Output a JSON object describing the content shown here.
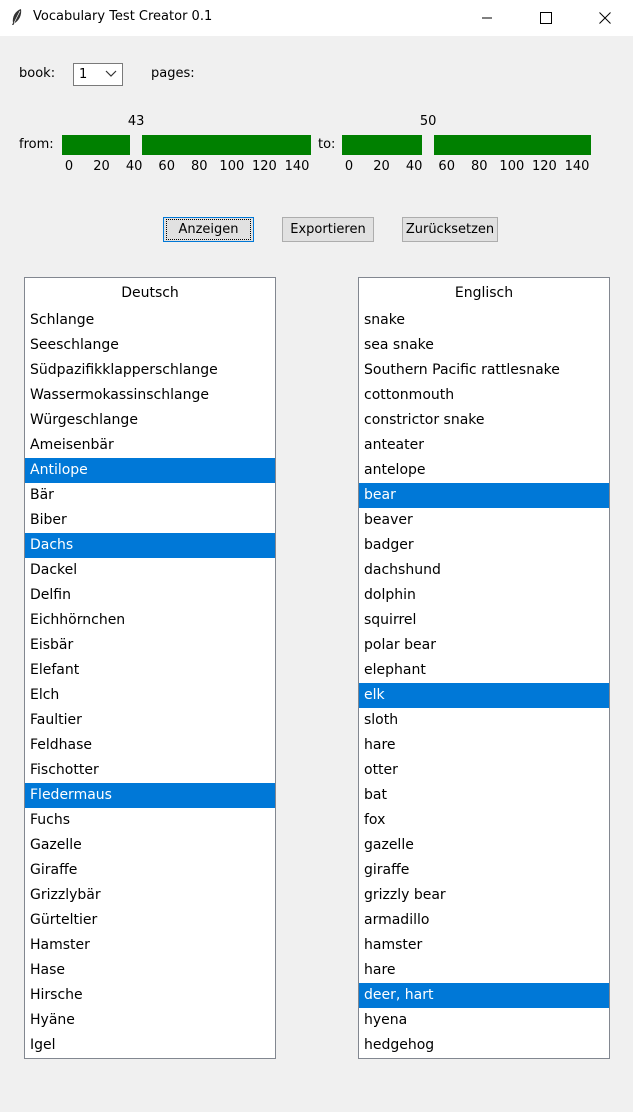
{
  "window": {
    "title": "Vocabulary Test Creator 0.1"
  },
  "controls": {
    "book_label": "book:",
    "book_value": "1",
    "pages_label": "pages:",
    "from_label": "from:",
    "to_label": "to:"
  },
  "sliders": {
    "from": {
      "value": 43,
      "min": 0,
      "max": 145
    },
    "to": {
      "value": 50,
      "min": 0,
      "max": 145
    },
    "tick_labels": [
      "0",
      "20",
      "40",
      "60",
      "80",
      "100",
      "120",
      "140"
    ]
  },
  "buttons": {
    "show": "Anzeigen",
    "export": "Exportieren",
    "reset": "Zurücksetzen"
  },
  "deutsch": {
    "header": "Deutsch",
    "items": [
      "Schlange",
      "Seeschlange",
      "Südpazifikklapperschlange",
      "Wassermokassinschlange",
      "Würgeschlange",
      "Ameisenbär",
      "Antilope",
      "Bär",
      "Biber",
      "Dachs",
      "Dackel",
      "Delfin",
      "Eichhörnchen",
      "Eisbär",
      "Elefant",
      "Elch",
      "Faultier",
      "Feldhase",
      "Fischotter",
      "Fledermaus",
      "Fuchs",
      "Gazelle",
      "Giraffe",
      "Grizzlybär",
      "Gürteltier",
      "Hamster",
      "Hase",
      "Hirsche",
      "Hyäne",
      "Igel"
    ],
    "selected": [
      "Antilope",
      "Dachs",
      "Fledermaus"
    ]
  },
  "englisch": {
    "header": "Englisch",
    "items": [
      "snake",
      "sea snake",
      "Southern Pacific rattlesnake",
      "cottonmouth",
      "constrictor snake",
      "anteater",
      "antelope",
      "bear",
      "beaver",
      "badger",
      "dachshund",
      "dolphin",
      "squirrel",
      "polar bear",
      "elephant",
      "elk",
      "sloth",
      "hare",
      "otter",
      "bat",
      "fox",
      "gazelle",
      "giraffe",
      "grizzly bear",
      "armadillo",
      "hamster",
      "hare",
      "deer, hart",
      "hyena",
      "hedgehog"
    ],
    "selected": [
      "bear",
      "elk",
      "deer, hart"
    ]
  }
}
